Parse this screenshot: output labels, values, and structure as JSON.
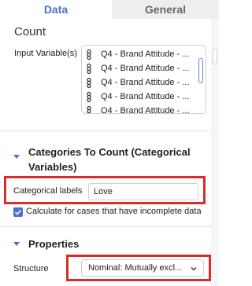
{
  "tabs": [
    {
      "label": "Data",
      "active": true
    },
    {
      "label": "General",
      "active": false
    }
  ],
  "count_heading": "Count",
  "input_variables": {
    "label": "Input Variable(s)",
    "items": [
      "Q4 - Brand Attitude - ...",
      "Q4 - Brand Attitude - ...",
      "Q4 - Brand Attitude - ...",
      "Q4 - Brand Attitude - ...",
      "Q4 - Brand Attitude - ..."
    ],
    "item_icon": "categorical-variable-icon"
  },
  "categories_section": {
    "title": "Categories To Count (Categorical Variables)",
    "title_line1": "Categories To Count (Categorical",
    "title_line2": "Variables)",
    "categorical_labels_label": "Categorical labels",
    "categorical_labels_value": "Love",
    "incomplete_checkbox_label": "Calculate for cases that have incomplete data",
    "incomplete_checked": true
  },
  "properties_section": {
    "title": "Properties",
    "structure_label": "Structure",
    "structure_value": "Nominal: Mutually excl..."
  },
  "colors": {
    "accent": "#4a6fcf",
    "highlight_box": "#d32f2f"
  }
}
